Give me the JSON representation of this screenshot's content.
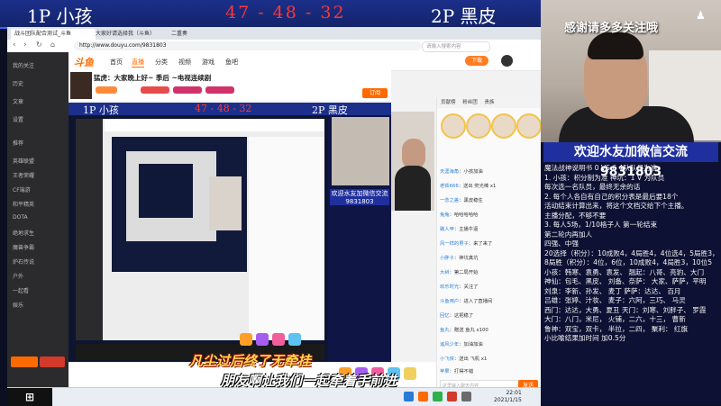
{
  "overlay": {
    "player1": "1P  小孩",
    "score": "47 - 48 - 32",
    "player2": "2P  黑皮"
  },
  "right_panel": {
    "thanks": "感谢请多多关注哦",
    "welcome": "欢迎水友加微信交流9831803",
    "rules": [
      "魔法战神说明书  0 VS 6 4队队员为准",
      "1. 小孩：积分制为准  神坑：1 V  为队员",
      "每次选一名队员，最终无余的话",
      "2. 每个人各自有自己的积分表是最后要18个",
      "活动结束计算出来，将这个文档交给下个主播。",
      "主播分配，不够不要",
      "3. 每人5场，1/10格子人 第一轮结束",
      "第二轮内再加人",
      "四强、中强",
      "20选择（积分）：10成败4，4局胜4，4位选4，5局胜3，3局胜2",
      "8局胜（积分）：4位，6位，10成败4，4局胜3，10位5",
      "小孩：韩寒、袁勇、袁发、  翘起：八哥、亮豹、大门",
      "神仙：包毛、黑皮、  刘备、奈萨：  大家、萨萨，平明",
      "刘泉：李新、孙发、 麦丁  萨萨：达达、  百月",
      "吕雄：张婷、汁妆、  麦子：六阿，三巧、  马灵",
      "西门：达达，大勇、夏丑  天门：刘寒、刘胖子、  罗霞",
      "大门：八门，米尼，  火铺，二六，十三，  曹新",
      "鲁神：双宝，双卡，  半拉，二四，  聚利：  红旗",
      "小比喻结果加时间   加0.5分"
    ]
  },
  "browser": {
    "tabs": [
      "战斗团队配合测试_斗鱼",
      "大家好请选择我（斗鱼）",
      "二重奏"
    ],
    "url": "http://www.douyu.com/9831803",
    "search_placeholder": "请输入搜索内容",
    "logo": "斗鱼",
    "nav": [
      "首页",
      "直播",
      "分类",
      "视频",
      "游戏",
      "鱼吧"
    ],
    "download": "下载",
    "stream_title": "猛虎：大家晚上好~  季后  ~电视连续剧",
    "subscribe": "订阅",
    "sidebar": [
      "我的关注",
      "历史",
      "文章",
      "设置",
      "推荐",
      "英雄联盟",
      "王者荣耀",
      "CF端游",
      "和平精英",
      "DOTA",
      "绝地求生",
      "魔兽争霸",
      "炉石传说",
      "户外",
      "一起看",
      "娱乐"
    ],
    "chat_tabs": [
      "贡献榜",
      "粉丝团",
      "贵族"
    ],
    "chat_messages": [
      {
        "name": "天涯海角",
        "text": "小孩加油"
      },
      {
        "name": "老铁666",
        "text": "送出 荧光棒 x1"
      },
      {
        "name": "一念之差",
        "text": "黑皮稳住"
      },
      {
        "name": "兔兔",
        "text": "哈哈哈哈哈"
      },
      {
        "name": "路人甲",
        "text": "主播牛逼"
      },
      {
        "name": "风一样的男子",
        "text": "来了来了"
      },
      {
        "name": "小胖子",
        "text": "神坑真坑"
      },
      {
        "name": "大树",
        "text": "第二局开始"
      },
      {
        "name": "欢乐时光",
        "text": "关注了"
      },
      {
        "name": "斗鱼用户",
        "text": "进入了直播间"
      },
      {
        "name": "回忆",
        "text": "这把稳了"
      },
      {
        "name": "鱼丸",
        "text": "赠送 鱼丸 x100"
      },
      {
        "name": "追风少年",
        "text": "加油加油"
      },
      {
        "name": "小飞侠",
        "text": "送出 飞机 x1"
      },
      {
        "name": "苹果",
        "text": "打得不错"
      }
    ],
    "chat_input_placeholder": "这里输入聊天内容",
    "send": "发送",
    "clock_time": "22:01",
    "clock_date": "2021/1/15"
  },
  "subtitles": {
    "line1": "凡尘过后终了无牵挂",
    "line2": "朋友啊让我们一起牵着手前进"
  },
  "mini": {
    "p1": "1P 小孩",
    "score": "47 - 48 - 32",
    "p2": "2P 黑皮",
    "welcome": "欢迎水友加微信交流9831803"
  }
}
